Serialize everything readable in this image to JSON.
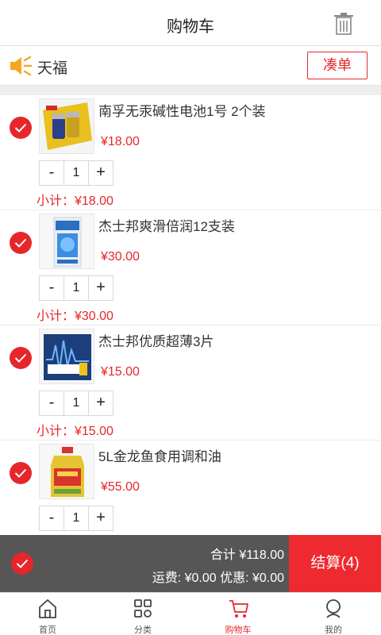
{
  "header": {
    "title": "购物车"
  },
  "shop": {
    "name": "天福",
    "combine_label": "凑单"
  },
  "cart": {
    "items": [
      {
        "name": "南孚无汞碱性电池1号 2个装",
        "price": "¥18.00",
        "qty": "1",
        "subtotal": "小计：¥18.00",
        "minus": "-",
        "plus": "+"
      },
      {
        "name": "杰士邦爽滑倍润12支装",
        "price": "¥30.00",
        "qty": "1",
        "subtotal": "小计：¥30.00",
        "minus": "-",
        "plus": "+"
      },
      {
        "name": "杰士邦优质超薄3片",
        "price": "¥15.00",
        "qty": "1",
        "subtotal": "小计：¥15.00",
        "minus": "-",
        "plus": "+"
      },
      {
        "name": "5L金龙鱼食用调和油",
        "price": "¥55.00",
        "qty": "1",
        "subtotal": "",
        "minus": "-",
        "plus": "+"
      }
    ]
  },
  "checkout": {
    "total": "合计 ¥118.00",
    "fees": "运费: ¥0.00 优惠: ¥0.00",
    "settle_label": "结算(4)"
  },
  "tabbar": {
    "tabs": [
      {
        "label": "首页",
        "icon": "home-icon"
      },
      {
        "label": "分类",
        "icon": "category-icon"
      },
      {
        "label": "购物车",
        "icon": "cart-icon"
      },
      {
        "label": "我的",
        "icon": "user-icon"
      }
    ]
  },
  "colors": {
    "accent": "#e7262c",
    "checkout_bar": "#565656",
    "settle": "#ee2a30"
  }
}
